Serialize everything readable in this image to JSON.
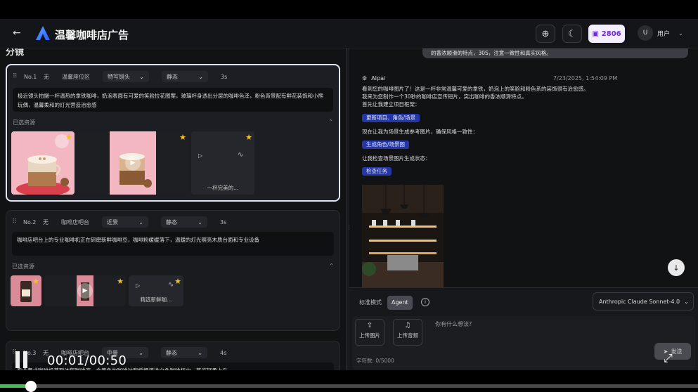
{
  "header": {
    "back_icon": "arrow-left-icon",
    "title": "温馨咖啡店广告",
    "credits": "2806",
    "user_initial": "U",
    "user_label": "用户"
  },
  "left": {
    "section_title": "分镜",
    "shots": [
      {
        "no": "No.1",
        "transition": "无",
        "location": "温馨座位区",
        "shot_type": "特写镜头",
        "motion": "静态",
        "duration": "3s",
        "description": "极近镜头拍摄一杯温热的拿铁咖啡，奶泡表面有可爱的笑脸拉花图案，玻璃杯身透出分层的咖啡色泽，粉色背景配有鲜花装饰和小熊玩偶，温馨柔和的灯光营造治愈感",
        "resources_label": "已选资源",
        "audio_label": "一杯完美的..."
      },
      {
        "no": "No.2",
        "transition": "无",
        "location": "咖啡店吧台",
        "shot_type": "近景",
        "motion": "静态",
        "duration": "3s",
        "description": "咖啡店吧台上的专业咖啡机正在研磨新鲜咖啡豆，咖啡粉缓缓落下，温暖的灯光照亮木质台面和专业设备",
        "resources_label": "已选资源",
        "audio_label": "精选新鲜咖..."
      },
      {
        "no": "No.3",
        "transition": "无",
        "location": "咖啡店吧台",
        "shot_type": "中景",
        "motion": "静态",
        "duration": "4s",
        "description": "专业意式咖啡机萃取浓郁咖啡液，金黄色的咖啡油脂缓慢流进白色咖啡杯中，蒸汽轻柔上升"
      }
    ]
  },
  "right": {
    "user_message": "的香浓顺滑的特点，30S，注意一致性和真实风格。",
    "bot_name": "AIpai",
    "bot_time": "7/23/2025, 1:54:09 PM",
    "messages": [
      "看到您的咖啡图片了！这是一杯非常温馨可爱的拿铁，奶泡上的笑脸和粉色系的装饰很有治愈感。",
      "我来为您制作一个30秒的咖啡店宣传短片，突出咖啡的香浓顺滑特点。",
      "首先让我建立项目框架："
    ],
    "pill_1": "更新项目、角色/场景",
    "msg_2": "现在让我为场景生成参考图片，确保风格一致性：",
    "pill_2": "生成角色/场景图",
    "msg_3": "让我检查场景图片生成状态：",
    "pill_3": "检查任务",
    "composer": {
      "mode_standard": "标准模式",
      "mode_agent": "Agent",
      "model": "Anthropic Claude Sonnet-4.0",
      "upload_image": "上传图片",
      "upload_audio": "上传音频",
      "placeholder": "你有什么想法?",
      "counter": "字符数: 0/5000",
      "send": "发送"
    }
  },
  "player": {
    "time": "00:01/00:50",
    "progress": 0.044
  },
  "colors": {
    "accent_pill": "#2436a8",
    "star": "#f5c21b",
    "credits_text": "#6b2bd9",
    "progress": "#3fbf4f"
  }
}
